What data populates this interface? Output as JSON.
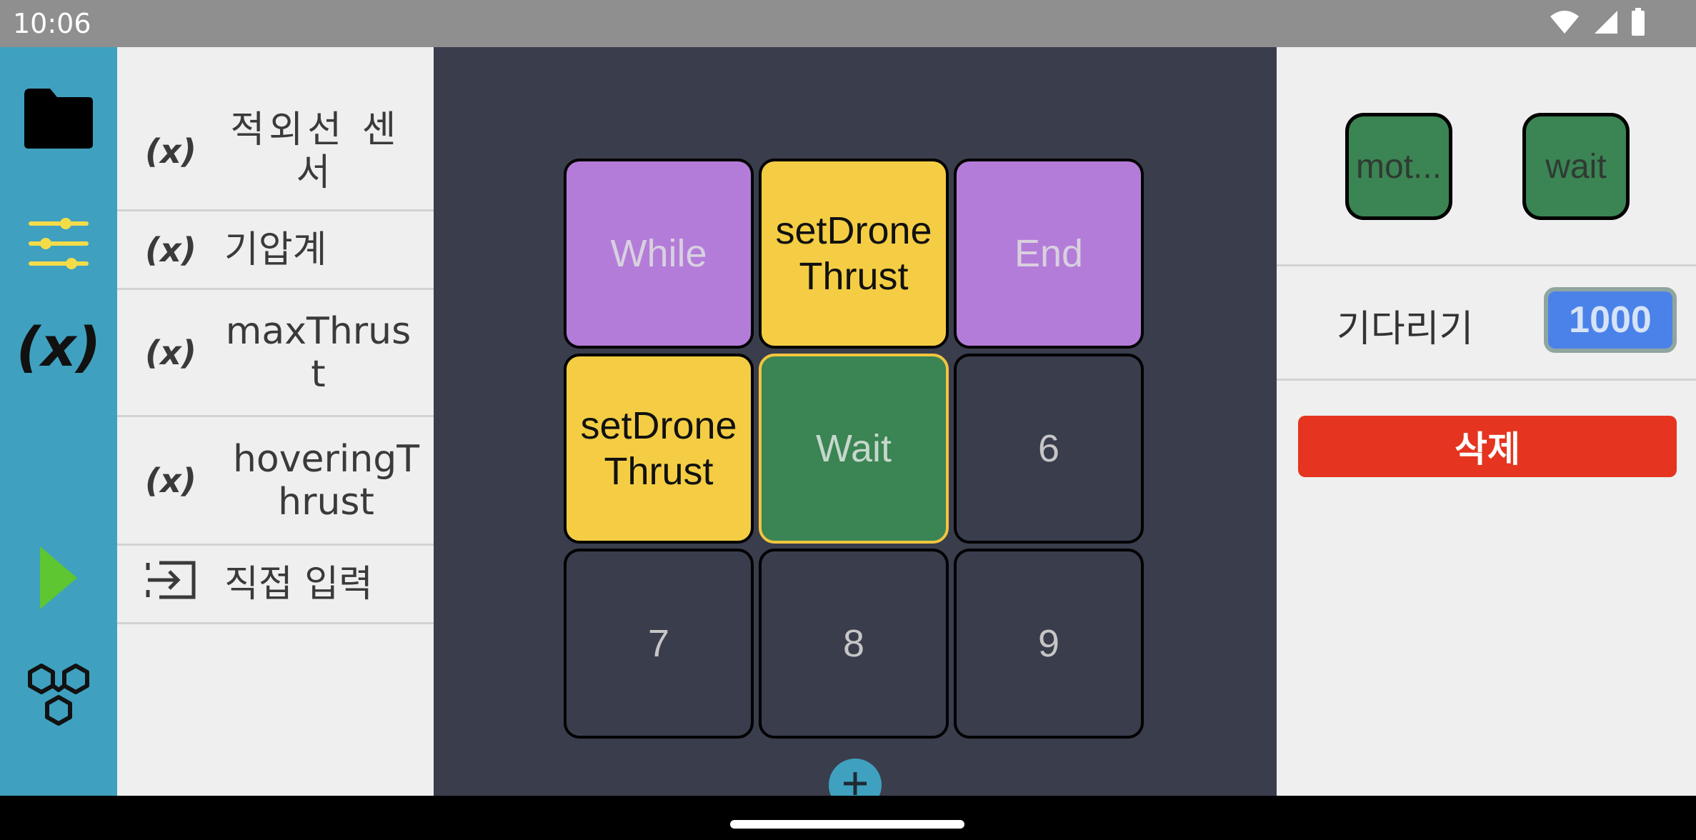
{
  "status_bar": {
    "time": "10:06",
    "icons": [
      "wifi-icon",
      "signal-icon",
      "battery-icon"
    ]
  },
  "rail": {
    "items": [
      {
        "name": "folder-icon",
        "color": "#000000"
      },
      {
        "name": "sliders-icon",
        "color": "#f4dc49"
      },
      {
        "name": "variable-icon",
        "label": "(x)",
        "color": "#111111"
      },
      {
        "name": "play-icon",
        "color": "#5ec631"
      },
      {
        "name": "hexagons-icon",
        "color": "#111111"
      }
    ]
  },
  "variables": {
    "items": [
      {
        "icon": "(x)",
        "label": "적외선 센서"
      },
      {
        "icon": "(x)",
        "label": "기압계"
      },
      {
        "icon": "(x)",
        "label": "maxThrust"
      },
      {
        "icon": "(x)",
        "label": "hoveringThrust"
      }
    ],
    "direct_input": {
      "icon": "input-icon",
      "label": "직접 입력"
    }
  },
  "grid": {
    "cells": [
      {
        "label": "While",
        "style": "purple"
      },
      {
        "label": "setDrone Thrust",
        "style": "yellow"
      },
      {
        "label": "End",
        "style": "purple"
      },
      {
        "label": "setDrone Thrust",
        "style": "yellow"
      },
      {
        "label": "Wait",
        "style": "green",
        "selected": true
      },
      {
        "label": "6",
        "style": "empty"
      },
      {
        "label": "7",
        "style": "empty"
      },
      {
        "label": "8",
        "style": "empty"
      },
      {
        "label": "9",
        "style": "empty"
      }
    ],
    "add_icon": "plus-icon"
  },
  "right_panel": {
    "chips": [
      "mot...",
      "wait"
    ],
    "wait_label": "기다리기",
    "wait_value": "1000",
    "delete_label": "삭제"
  },
  "colors": {
    "rail": "#3fa1bf",
    "canvas": "#3a3d4c",
    "block_purple": "#b47cd9",
    "block_yellow": "#f4cd44",
    "block_green": "#3b8453",
    "delete": "#e5341f",
    "input": "#4b82ea"
  }
}
